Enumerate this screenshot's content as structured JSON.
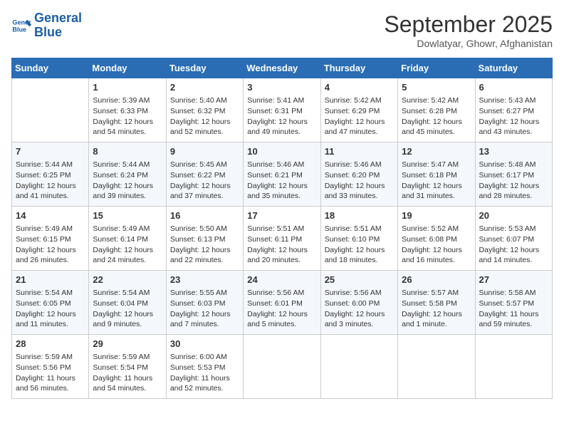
{
  "logo": {
    "line1": "General",
    "line2": "Blue"
  },
  "title": "September 2025",
  "location": "Dowlatyar, Ghowr, Afghanistan",
  "weekdays": [
    "Sunday",
    "Monday",
    "Tuesday",
    "Wednesday",
    "Thursday",
    "Friday",
    "Saturday"
  ],
  "weeks": [
    [
      {
        "day": "",
        "info": ""
      },
      {
        "day": "1",
        "info": "Sunrise: 5:39 AM\nSunset: 6:33 PM\nDaylight: 12 hours\nand 54 minutes."
      },
      {
        "day": "2",
        "info": "Sunrise: 5:40 AM\nSunset: 6:32 PM\nDaylight: 12 hours\nand 52 minutes."
      },
      {
        "day": "3",
        "info": "Sunrise: 5:41 AM\nSunset: 6:31 PM\nDaylight: 12 hours\nand 49 minutes."
      },
      {
        "day": "4",
        "info": "Sunrise: 5:42 AM\nSunset: 6:29 PM\nDaylight: 12 hours\nand 47 minutes."
      },
      {
        "day": "5",
        "info": "Sunrise: 5:42 AM\nSunset: 6:28 PM\nDaylight: 12 hours\nand 45 minutes."
      },
      {
        "day": "6",
        "info": "Sunrise: 5:43 AM\nSunset: 6:27 PM\nDaylight: 12 hours\nand 43 minutes."
      }
    ],
    [
      {
        "day": "7",
        "info": "Sunrise: 5:44 AM\nSunset: 6:25 PM\nDaylight: 12 hours\nand 41 minutes."
      },
      {
        "day": "8",
        "info": "Sunrise: 5:44 AM\nSunset: 6:24 PM\nDaylight: 12 hours\nand 39 minutes."
      },
      {
        "day": "9",
        "info": "Sunrise: 5:45 AM\nSunset: 6:22 PM\nDaylight: 12 hours\nand 37 minutes."
      },
      {
        "day": "10",
        "info": "Sunrise: 5:46 AM\nSunset: 6:21 PM\nDaylight: 12 hours\nand 35 minutes."
      },
      {
        "day": "11",
        "info": "Sunrise: 5:46 AM\nSunset: 6:20 PM\nDaylight: 12 hours\nand 33 minutes."
      },
      {
        "day": "12",
        "info": "Sunrise: 5:47 AM\nSunset: 6:18 PM\nDaylight: 12 hours\nand 31 minutes."
      },
      {
        "day": "13",
        "info": "Sunrise: 5:48 AM\nSunset: 6:17 PM\nDaylight: 12 hours\nand 28 minutes."
      }
    ],
    [
      {
        "day": "14",
        "info": "Sunrise: 5:49 AM\nSunset: 6:15 PM\nDaylight: 12 hours\nand 26 minutes."
      },
      {
        "day": "15",
        "info": "Sunrise: 5:49 AM\nSunset: 6:14 PM\nDaylight: 12 hours\nand 24 minutes."
      },
      {
        "day": "16",
        "info": "Sunrise: 5:50 AM\nSunset: 6:13 PM\nDaylight: 12 hours\nand 22 minutes."
      },
      {
        "day": "17",
        "info": "Sunrise: 5:51 AM\nSunset: 6:11 PM\nDaylight: 12 hours\nand 20 minutes."
      },
      {
        "day": "18",
        "info": "Sunrise: 5:51 AM\nSunset: 6:10 PM\nDaylight: 12 hours\nand 18 minutes."
      },
      {
        "day": "19",
        "info": "Sunrise: 5:52 AM\nSunset: 6:08 PM\nDaylight: 12 hours\nand 16 minutes."
      },
      {
        "day": "20",
        "info": "Sunrise: 5:53 AM\nSunset: 6:07 PM\nDaylight: 12 hours\nand 14 minutes."
      }
    ],
    [
      {
        "day": "21",
        "info": "Sunrise: 5:54 AM\nSunset: 6:05 PM\nDaylight: 12 hours\nand 11 minutes."
      },
      {
        "day": "22",
        "info": "Sunrise: 5:54 AM\nSunset: 6:04 PM\nDaylight: 12 hours\nand 9 minutes."
      },
      {
        "day": "23",
        "info": "Sunrise: 5:55 AM\nSunset: 6:03 PM\nDaylight: 12 hours\nand 7 minutes."
      },
      {
        "day": "24",
        "info": "Sunrise: 5:56 AM\nSunset: 6:01 PM\nDaylight: 12 hours\nand 5 minutes."
      },
      {
        "day": "25",
        "info": "Sunrise: 5:56 AM\nSunset: 6:00 PM\nDaylight: 12 hours\nand 3 minutes."
      },
      {
        "day": "26",
        "info": "Sunrise: 5:57 AM\nSunset: 5:58 PM\nDaylight: 12 hours\nand 1 minute."
      },
      {
        "day": "27",
        "info": "Sunrise: 5:58 AM\nSunset: 5:57 PM\nDaylight: 11 hours\nand 59 minutes."
      }
    ],
    [
      {
        "day": "28",
        "info": "Sunrise: 5:59 AM\nSunset: 5:56 PM\nDaylight: 11 hours\nand 56 minutes."
      },
      {
        "day": "29",
        "info": "Sunrise: 5:59 AM\nSunset: 5:54 PM\nDaylight: 11 hours\nand 54 minutes."
      },
      {
        "day": "30",
        "info": "Sunrise: 6:00 AM\nSunset: 5:53 PM\nDaylight: 11 hours\nand 52 minutes."
      },
      {
        "day": "",
        "info": ""
      },
      {
        "day": "",
        "info": ""
      },
      {
        "day": "",
        "info": ""
      },
      {
        "day": "",
        "info": ""
      }
    ]
  ]
}
